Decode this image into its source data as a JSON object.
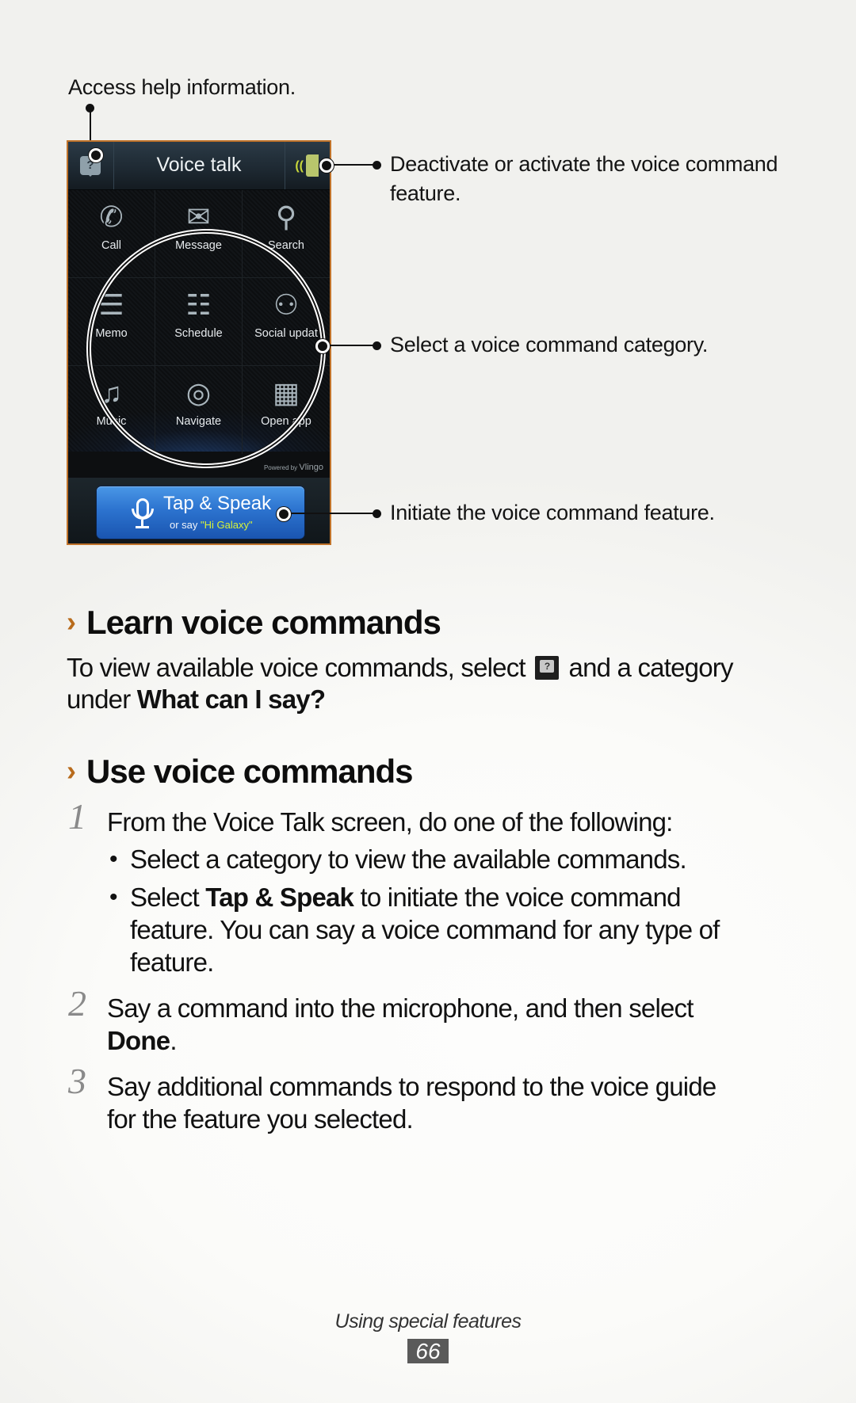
{
  "callouts": {
    "help": "Access help information.",
    "toggle_line1": "Deactivate or activate the voice command",
    "toggle_line2": "feature.",
    "category": "Select a voice command category.",
    "initiate": "Initiate the voice command feature."
  },
  "phone": {
    "title": "Voice talk",
    "help_icon": "help-speech-bubble-icon",
    "toggle_icon": "voice-toggle-icon",
    "help_glyph": "?",
    "categories": [
      {
        "label": "Call",
        "icon": "phone-icon",
        "glyph": "✆"
      },
      {
        "label": "Message",
        "icon": "envelope-icon",
        "glyph": "✉"
      },
      {
        "label": "Search",
        "icon": "magnifier-icon",
        "glyph": "⚲"
      },
      {
        "label": "Memo",
        "icon": "memo-icon",
        "glyph": "☰"
      },
      {
        "label": "Schedule",
        "icon": "schedule-icon",
        "glyph": "☷"
      },
      {
        "label": "Social updat",
        "icon": "social-icon",
        "glyph": "⚇"
      },
      {
        "label": "Music",
        "icon": "music-icon",
        "glyph": "♫"
      },
      {
        "label": "Navigate",
        "icon": "navigate-icon",
        "glyph": "◎"
      },
      {
        "label": "Open app",
        "icon": "apps-grid-icon",
        "glyph": "▦"
      }
    ],
    "powered_prefix": "Powered by",
    "powered_brand": "Vlingo",
    "tap_speak_label": "Tap & Speak",
    "tap_speak_sub_prefix": "or say ",
    "tap_speak_sub_phrase": "\"Hi Galaxy\""
  },
  "learn": {
    "chevron": "›",
    "heading": "Learn voice commands",
    "line1_a": "To view available voice commands, select",
    "line1_b": "and a category",
    "line2_a": "under ",
    "line2_bold": "What can I say?",
    "inline_icon_glyph": "?"
  },
  "use": {
    "chevron": "›",
    "heading": "Use voice commands",
    "steps": [
      {
        "num": "1",
        "text": "From the Voice Talk screen, do one of the following:",
        "bullets": [
          {
            "lines": [
              "Select a category to view the available commands."
            ]
          },
          {
            "prefix": "Select ",
            "bold": "Tap & Speak",
            "suffix": " to initiate the voice command",
            "lines": [
              "feature. You can say a voice command for any type of",
              "feature."
            ]
          }
        ]
      },
      {
        "num": "2",
        "line1": "Say a command into the microphone, and then select",
        "line2_bold": "Done",
        "line2_suffix": "."
      },
      {
        "num": "3",
        "line1": "Say additional commands to respond to the voice guide",
        "line2": "for the feature you selected."
      }
    ],
    "bullet_glyph": "•"
  },
  "footer": {
    "section": "Using special features",
    "page": "66"
  },
  "colors": {
    "accent_chevron": "#b86b1c",
    "phone_border": "#c0732a",
    "button_blue": "#2c73cf",
    "hi_galaxy": "#d6f23a",
    "page_num_bg": "#5a5a5a"
  }
}
